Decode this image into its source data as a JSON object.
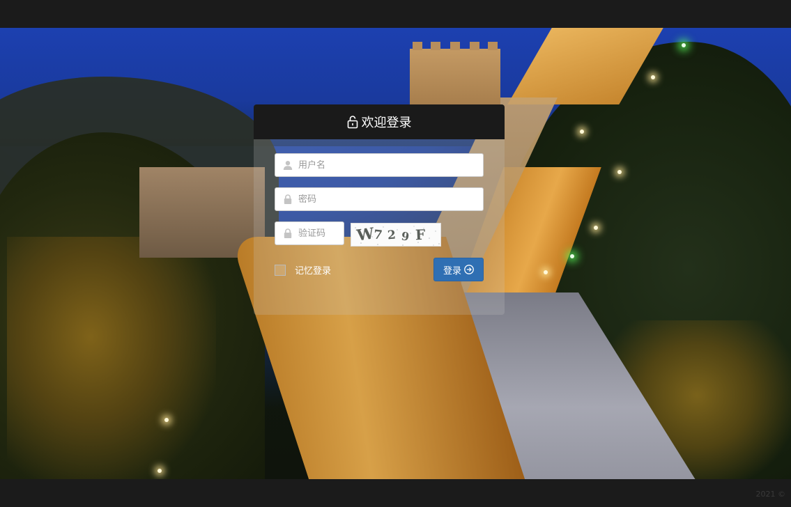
{
  "login": {
    "title": "欢迎登录",
    "username_placeholder": "用户名",
    "password_placeholder": "密码",
    "captcha_placeholder": "验证码",
    "captcha_text": "W729F",
    "remember_label": "记忆登录",
    "remember_checked": false,
    "submit_label": "登录"
  },
  "footer": {
    "copyright": "2021 ©"
  },
  "icons": {
    "title": "lock-icon",
    "username": "user-icon",
    "password": "lock-icon",
    "captcha": "lock-icon",
    "submit": "arrow-right-circle-icon"
  },
  "colors": {
    "accent": "#2f6fb3",
    "header_bg": "#1a1a1a",
    "page_bg": "#1b1b1b"
  }
}
